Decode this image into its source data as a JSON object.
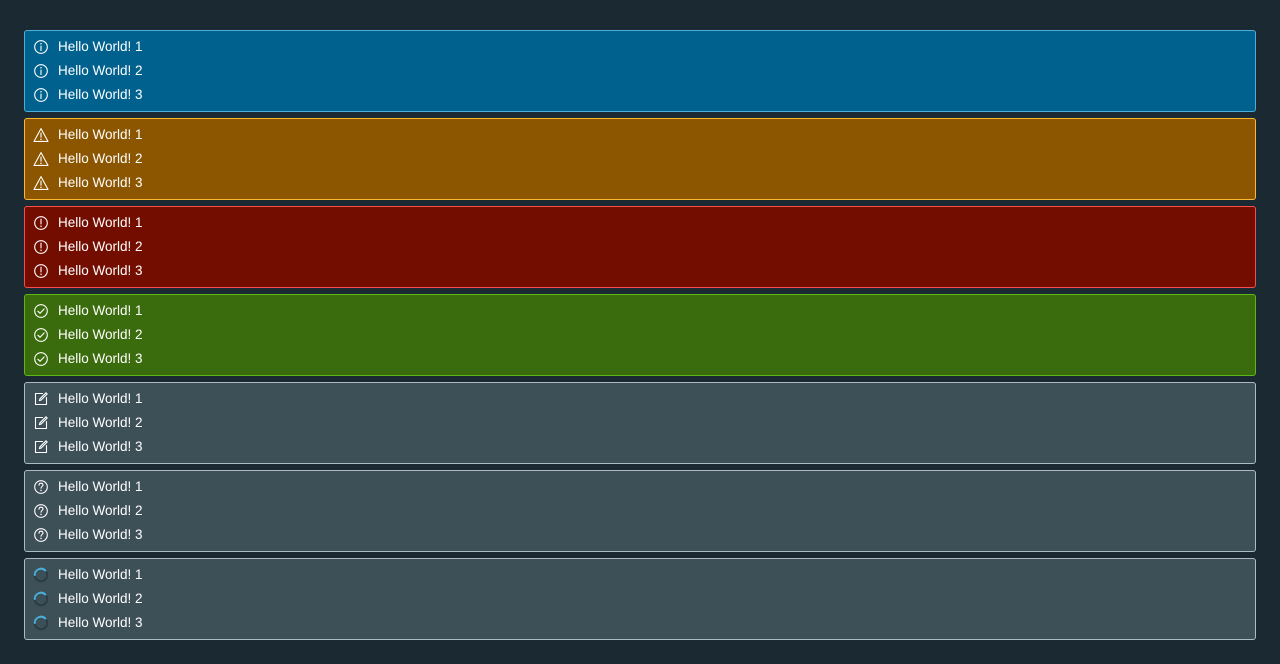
{
  "alerts": [
    {
      "type": "info",
      "icon": "info-icon",
      "background": "#00618e",
      "border": "#49afd9",
      "items": [
        "Hello World! 1",
        "Hello World! 2",
        "Hello World! 3"
      ]
    },
    {
      "type": "warning",
      "icon": "warning-icon",
      "background": "#8c5500",
      "border": "#ffb92e",
      "items": [
        "Hello World! 1",
        "Hello World! 2",
        "Hello World! 3"
      ]
    },
    {
      "type": "danger",
      "icon": "error-icon",
      "background": "#720d00",
      "border": "#f54f47",
      "items": [
        "Hello World! 1",
        "Hello World! 2",
        "Hello World! 3"
      ]
    },
    {
      "type": "success",
      "icon": "success-icon",
      "background": "#3a6b0c",
      "border": "#5eb715",
      "items": [
        "Hello World! 1",
        "Hello World! 2",
        "Hello World! 3"
      ]
    },
    {
      "type": "neutral",
      "icon": "edit-icon",
      "background": "#3d4f57",
      "border": "#adbbc4",
      "items": [
        "Hello World! 1",
        "Hello World! 2",
        "Hello World! 3"
      ]
    },
    {
      "type": "unknown",
      "icon": "help-icon",
      "background": "#3d4f57",
      "border": "#adbbc4",
      "items": [
        "Hello World! 1",
        "Hello World! 2",
        "Hello World! 3"
      ]
    },
    {
      "type": "loading",
      "icon": "spinner-icon",
      "background": "#3d4f57",
      "border": "#adbbc4",
      "items": [
        "Hello World! 1",
        "Hello World! 2",
        "Hello World! 3"
      ]
    }
  ]
}
